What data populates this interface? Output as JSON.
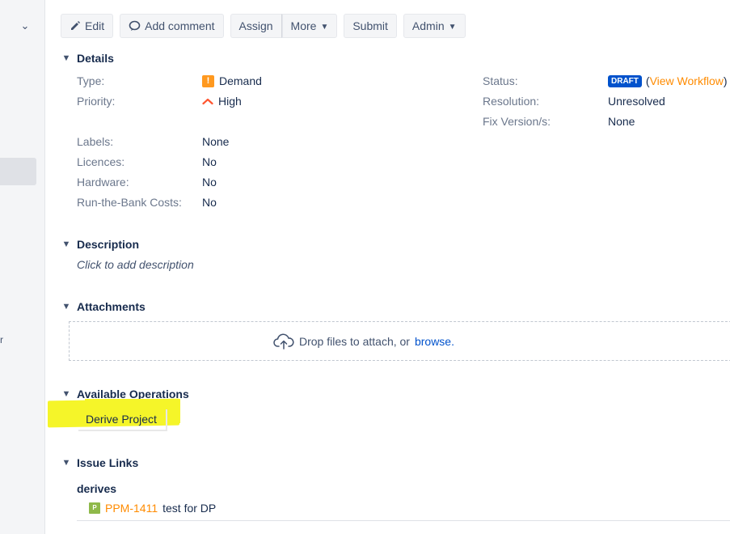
{
  "sidebar": {
    "collapse_icon": "chevron-down-icon",
    "stub_text": "r"
  },
  "toolbar": {
    "edit_label": "Edit",
    "add_comment_label": "Add comment",
    "assign_label": "Assign",
    "more_label": "More",
    "submit_label": "Submit",
    "admin_label": "Admin"
  },
  "details": {
    "heading": "Details",
    "left_fields": [
      {
        "label": "Type:",
        "value": "Demand"
      },
      {
        "label": "Priority:",
        "value": "High"
      },
      {
        "label": "Labels:",
        "value": "None"
      },
      {
        "label": "Licences:",
        "value": "No"
      },
      {
        "label": "Hardware:",
        "value": "No"
      },
      {
        "label": "Run-the-Bank Costs:",
        "value": "No"
      }
    ],
    "right_fields": [
      {
        "label": "Status:",
        "value": "DRAFT",
        "paren_open": "(",
        "link": "View Workflow",
        "paren_close": ")"
      },
      {
        "label": "Resolution:",
        "value": "Unresolved"
      },
      {
        "label": "Fix Version/s:",
        "value": "None"
      }
    ]
  },
  "description": {
    "heading": "Description",
    "placeholder": "Click to add description"
  },
  "attachments": {
    "heading": "Attachments",
    "drop_text": "Drop files to attach, or",
    "browse_link": "browse."
  },
  "operations": {
    "heading": "Available Operations",
    "derive_label": "Derive Project"
  },
  "issue_links": {
    "heading": "Issue Links",
    "link_type": "derives",
    "items": [
      {
        "key": "PPM-1411",
        "summary": "test for DP"
      }
    ]
  },
  "colors": {
    "accent_link": "#ff8b00",
    "status_lozenge": "#0052cc",
    "highlight": "#f5f529"
  }
}
